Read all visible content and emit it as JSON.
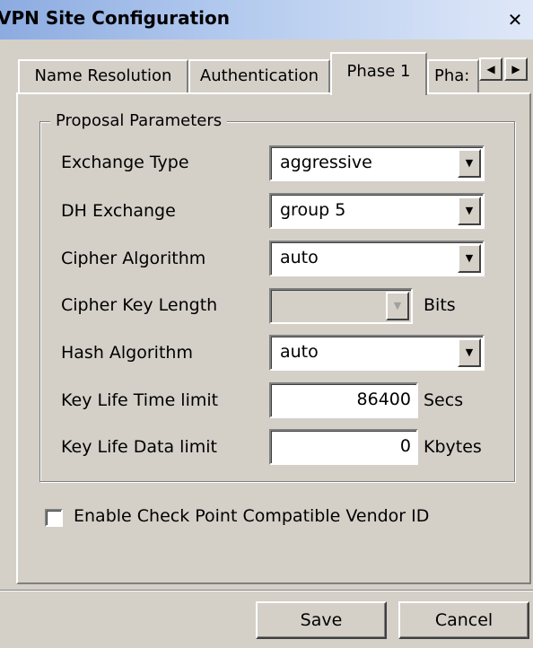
{
  "window": {
    "title": "VPN Site Configuration",
    "close_glyph": "✕"
  },
  "tabs": [
    {
      "label": "Name Resolution",
      "active": false
    },
    {
      "label": "Authentication",
      "active": false
    },
    {
      "label": "Phase 1",
      "active": true
    },
    {
      "label": "Pha:",
      "active": false
    }
  ],
  "tab_scroll": {
    "left_glyph": "◀",
    "right_glyph": "▶"
  },
  "proposal": {
    "group_title": "Proposal Parameters",
    "exchange_type": {
      "label": "Exchange Type",
      "value": "aggressive"
    },
    "dh_exchange": {
      "label": "DH Exchange",
      "value": "group 5"
    },
    "cipher_algorithm": {
      "label": "Cipher Algorithm",
      "value": "auto"
    },
    "cipher_key_length": {
      "label": "Cipher Key Length",
      "value": "",
      "unit": "Bits"
    },
    "hash_algorithm": {
      "label": "Hash Algorithm",
      "value": "auto"
    },
    "key_life_time": {
      "label": "Key Life Time limit",
      "value": "86400",
      "unit": "Secs"
    },
    "key_life_data": {
      "label": "Key Life Data limit",
      "value": "0",
      "unit": "Kbytes"
    }
  },
  "vendor_id": {
    "label": "Enable Check Point Compatible Vendor ID",
    "checked": false
  },
  "buttons": {
    "save": "Save",
    "cancel": "Cancel"
  },
  "dropdown_glyph": "▼"
}
